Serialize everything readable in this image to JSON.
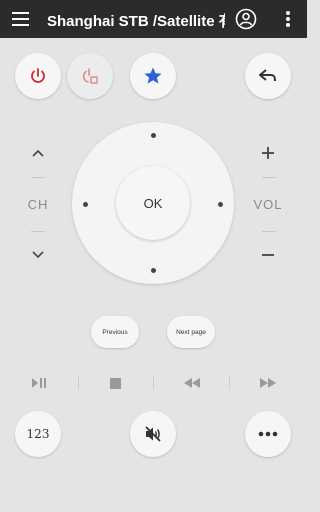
{
  "header": {
    "title": "Shanghai STB /Satellite 有",
    "icons": [
      "menu-icon",
      "account-icon",
      "more-vert-icon"
    ]
  },
  "top_controls": {
    "icons": [
      "power-icon",
      "power-timer-icon",
      "star-icon",
      "back-icon"
    ],
    "colors": {
      "power": "#cc2b2b",
      "power_timer": "#d98a8a",
      "star": "#2a63d6",
      "back": "#333333"
    }
  },
  "channel": {
    "label": "CH"
  },
  "volume": {
    "label": "VOL"
  },
  "dpad": {
    "ok_label": "OK"
  },
  "nav": {
    "previous_label": "Previous",
    "next_label": "Next page"
  },
  "media": {
    "icons": [
      "play-pause-icon",
      "stop-icon",
      "rewind-icon",
      "fast-forward-icon"
    ]
  },
  "bottom": {
    "numpad_label": "123",
    "icons": [
      "mute-icon",
      "more-horiz-icon"
    ]
  }
}
